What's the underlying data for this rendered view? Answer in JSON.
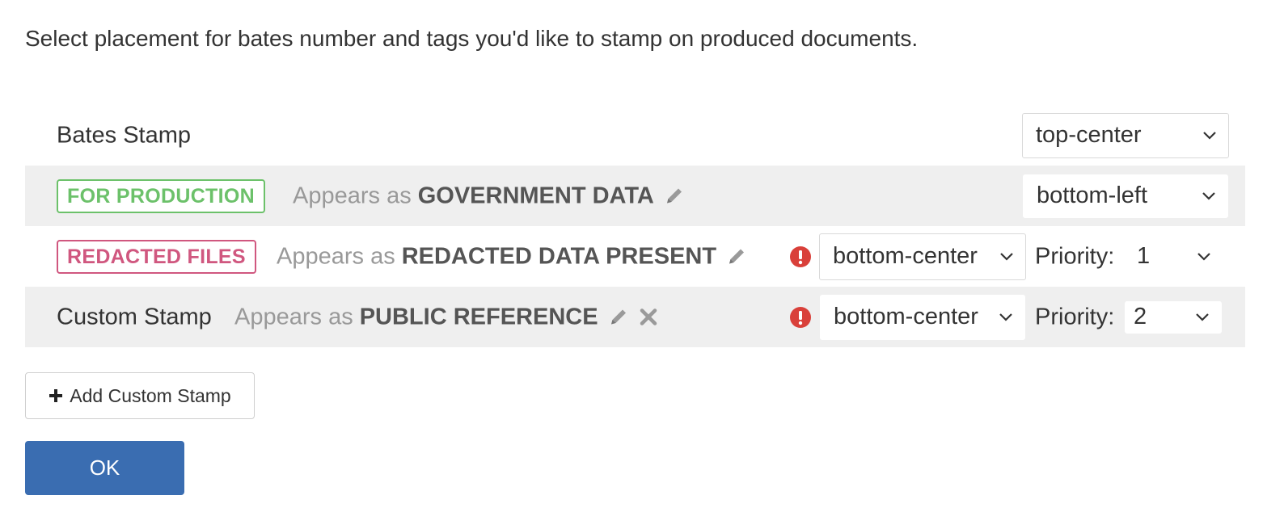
{
  "intro_text": "Select placement for bates number and tags you'd like to stamp on produced documents.",
  "rows": [
    {
      "label": "Bates Stamp",
      "placement": "top-center"
    },
    {
      "tag": "FOR PRODUCTION",
      "tag_color": "#6cc16a",
      "appears_prefix": "Appears as",
      "appears_value": "GOVERNMENT DATA",
      "placement": "bottom-left"
    },
    {
      "tag": "REDACTED FILES",
      "tag_color": "#d0577f",
      "appears_prefix": "Appears as",
      "appears_value": "REDACTED DATA PRESENT",
      "warning_icon": "exclamation-circle-icon",
      "placement": "bottom-center",
      "priority_label": "Priority:",
      "priority": "1"
    },
    {
      "label": "Custom Stamp",
      "appears_prefix": "Appears as",
      "appears_value": "PUBLIC REFERENCE",
      "warning_icon": "exclamation-circle-icon",
      "placement": "bottom-center",
      "priority_label": "Priority:",
      "priority": "2"
    }
  ],
  "add_button_label": "Add Custom Stamp",
  "ok_button_label": "OK",
  "colors": {
    "primary": "#3a6db1",
    "warning": "#d9403a",
    "row_alt_bg": "#efefef"
  }
}
